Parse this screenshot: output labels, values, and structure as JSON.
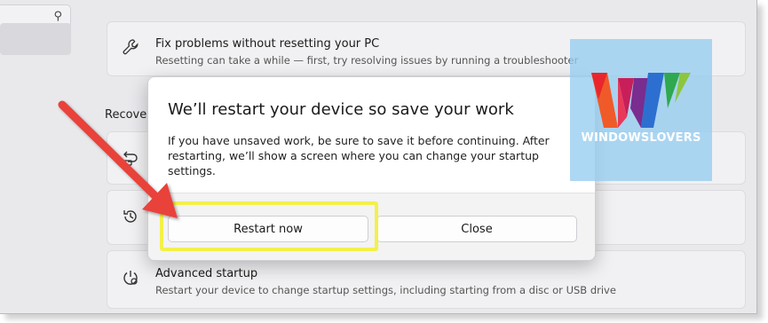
{
  "sidebar": {
    "search_icon": "search-icon"
  },
  "section_label": "Recover",
  "cards": {
    "troubleshoot": {
      "icon": "wrench-icon",
      "title": "Fix problems without resetting your PC",
      "description": "Resetting can take a while — first, try resolving issues by running a troubleshooter"
    },
    "reset": {
      "icon": "reset-pc-icon"
    },
    "go_back": {
      "icon": "history-icon"
    },
    "advanced": {
      "icon": "advanced-startup-icon",
      "title": "Advanced startup",
      "description": "Restart your device to change startup settings, including starting from a disc or USB drive"
    }
  },
  "dialog": {
    "title": "We’ll restart your device so save your work",
    "body": "If you have unsaved work, be sure to save it before continuing. After restarting, we’ll show a screen where you can change your startup settings.",
    "restart_label": "Restart now",
    "close_label": "Close"
  },
  "watermark": {
    "text_a": "WINDOWS",
    "text_b": "LOVERS"
  },
  "colors": {
    "highlight": "#f3f04c",
    "arrow": "#e8423a"
  }
}
